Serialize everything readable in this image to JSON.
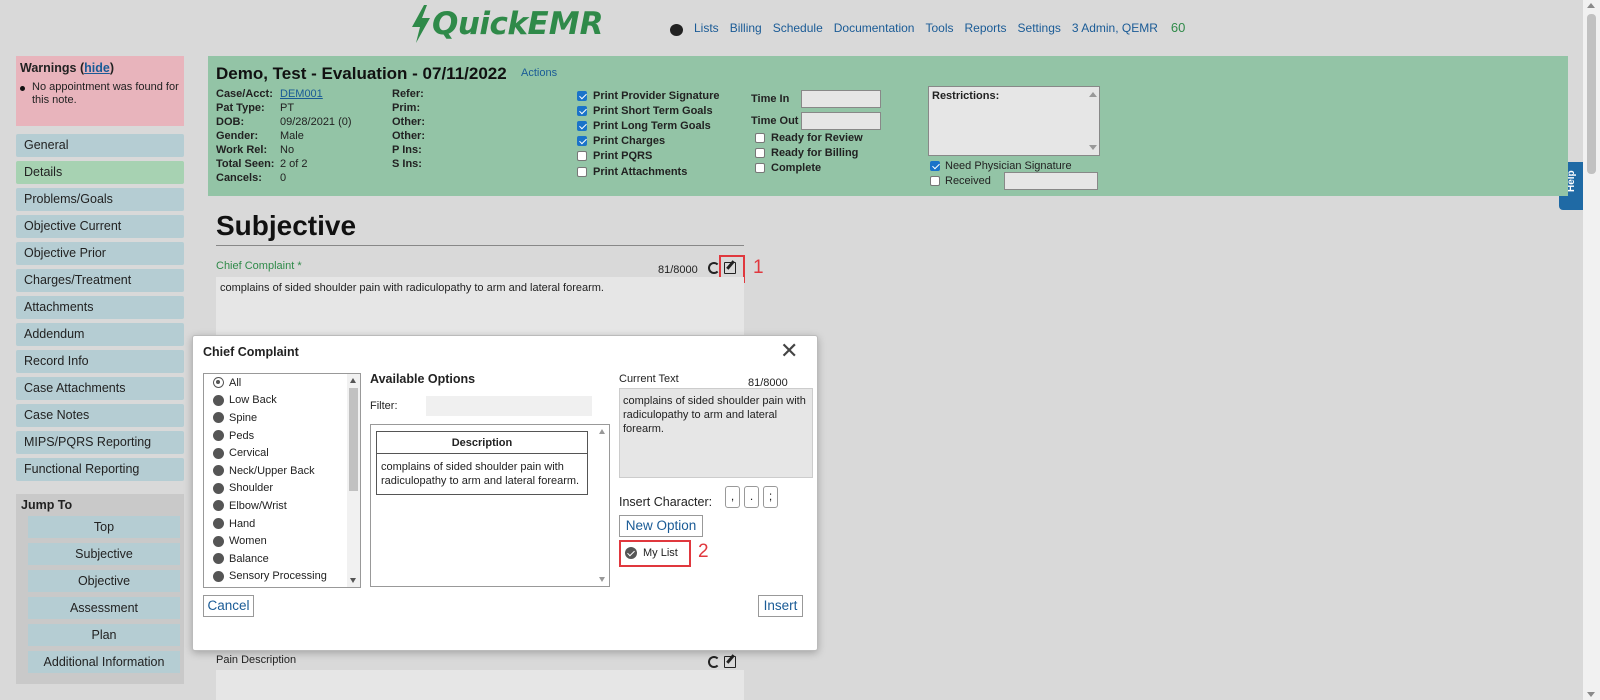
{
  "app": {
    "logo_quick": "Quick",
    "logo_emr": "EMR",
    "nav": [
      "Lists",
      "Billing",
      "Schedule",
      "Documentation",
      "Tools",
      "Reports",
      "Settings",
      "3 Admin, QEMR"
    ],
    "nav_count": "60",
    "help_label": "Help"
  },
  "warnings": {
    "title": "Warnings (",
    "hide_link": "hide",
    "title_end": ")",
    "items": [
      "No appointment was found for this note."
    ]
  },
  "sidebar": {
    "items": [
      "General",
      "Details",
      "Problems/Goals",
      "Objective Current",
      "Objective Prior",
      "Charges/Treatment",
      "Attachments",
      "Addendum",
      "Record Info",
      "Case Attachments",
      "Case Notes",
      "MIPS/PQRS Reporting",
      "Functional Reporting"
    ],
    "active": "Details"
  },
  "jump_to": {
    "title": "Jump To",
    "items": [
      "Top",
      "Subjective",
      "Objective",
      "Assessment",
      "Plan",
      "Additional Information"
    ]
  },
  "header": {
    "title": "Demo, Test - Evaluation - 07/11/2022",
    "actions_label": "Actions",
    "patient_info": [
      {
        "label": "Case/Acct:",
        "value": "DEM001"
      },
      {
        "label": "Pat Type:",
        "value": "PT"
      },
      {
        "label": "DOB:",
        "value": "09/28/2021 (0)"
      },
      {
        "label": "Gender:",
        "value": "Male"
      },
      {
        "label": "Work Rel:",
        "value": "No"
      },
      {
        "label": "Total Seen:",
        "value": "2 of 2"
      },
      {
        "label": "Cancels:",
        "value": "0"
      }
    ],
    "insurance_labels": [
      "Refer:",
      "Prim:",
      "Other:",
      "Other:",
      "P Ins:",
      "S Ins:"
    ],
    "print_options": [
      {
        "label": "Print Provider Signature",
        "checked": true
      },
      {
        "label": "Print Short Term Goals",
        "checked": true
      },
      {
        "label": "Print Long Term Goals",
        "checked": true
      },
      {
        "label": "Print Charges",
        "checked": true
      },
      {
        "label": "Print PQRS",
        "checked": false
      },
      {
        "label": "Print Attachments",
        "checked": false
      }
    ],
    "time_in_label": "Time In",
    "time_out_label": "Time Out",
    "status_options": [
      {
        "label": "Ready for Review",
        "checked": false
      },
      {
        "label": "Ready for Billing",
        "checked": false
      },
      {
        "label": "Complete",
        "checked": false
      }
    ],
    "restrictions_label": "Restrictions:",
    "need_physician_signature": {
      "label": "Need Physician Signature",
      "checked": true
    },
    "received": {
      "label": "Received",
      "checked": false
    }
  },
  "main": {
    "section_title": "Subjective",
    "chief_complaint_label": "Chief Complaint *",
    "chief_complaint_count": "81/8000",
    "chief_complaint_text": "complains of  sided shoulder pain with radiculopathy to  arm and lateral forearm.",
    "pain_description_label": "Pain Description",
    "annotation_1": "1",
    "annotation_2": "2"
  },
  "modal": {
    "title": "Chief Complaint",
    "close_label": "✕",
    "categories": [
      "All",
      "Low Back",
      "Spine",
      "Peds",
      "Cervical",
      "Neck/Upper Back",
      "Shoulder",
      "Elbow/Wrist",
      "Hand",
      "Women",
      "Balance",
      "Sensory Processing"
    ],
    "selected_category": "All",
    "available_title": "Available Options",
    "filter_label": "Filter:",
    "filter_value": "",
    "table_header": "Description",
    "options": [
      "complains of sided shoulder pain with radiculopathy to arm and lateral forearm."
    ],
    "current_text_label": "Current Text",
    "current_count": "81/8000",
    "current_text": "complains of  sided shoulder pain with radiculopathy to  arm and lateral forearm.",
    "insert_char_label": "Insert Character:",
    "insert_chars": [
      ",",
      ".",
      ";"
    ],
    "new_option_label": "New Option",
    "my_list_label": "My List",
    "my_list_checked": true,
    "cancel_label": "Cancel",
    "insert_label": "Insert"
  },
  "colors": {
    "brand_green": "#2f8a49",
    "header_green": "#93c4a6",
    "link_blue": "#1a5b96",
    "highlight_red": "#e0383e"
  }
}
